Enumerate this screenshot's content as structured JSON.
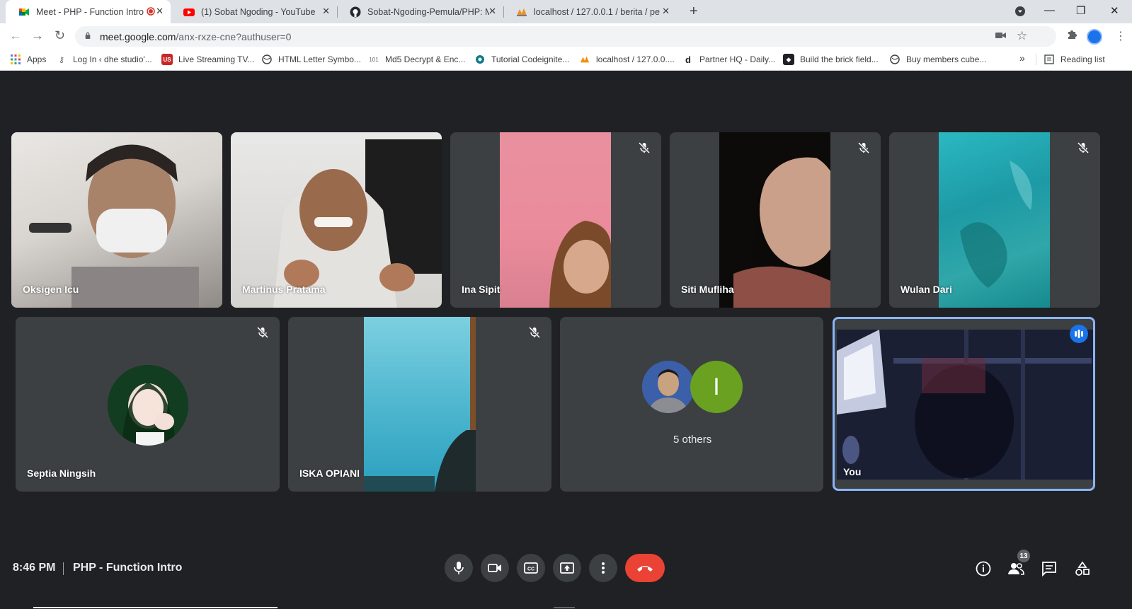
{
  "browser": {
    "tabs": [
      {
        "title": "Meet - PHP - Function Intro",
        "icon": "google-meet-icon",
        "active": true
      },
      {
        "title": "(1) Sobat Ngoding - YouTube",
        "icon": "youtube-icon",
        "active": false
      },
      {
        "title": "Sobat-Ngoding-Pemula/PHP: Ma",
        "icon": "github-icon",
        "active": false
      },
      {
        "title": "localhost / 127.0.0.1 / berita / pe",
        "icon": "phpmyadmin-icon",
        "active": false
      }
    ],
    "url_host": "meet.google.com",
    "url_path": "/anx-rxze-cne?authuser=0",
    "bookmarks": [
      {
        "label": "Apps",
        "icon": "apps-grid-icon"
      },
      {
        "label": "Log In ‹ dhe studio'...",
        "icon": "key-icon"
      },
      {
        "label": "Live Streaming TV...",
        "icon": "tv-icon"
      },
      {
        "label": "HTML Letter Symbo...",
        "icon": "globe-icon"
      },
      {
        "label": "Md5 Decrypt & Enc...",
        "icon": "md5-icon"
      },
      {
        "label": "Tutorial Codeignite...",
        "icon": "codeigniter-icon"
      },
      {
        "label": "localhost / 127.0.0....",
        "icon": "phpmyadmin-icon"
      },
      {
        "label": "Partner HQ - Daily...",
        "icon": "d-icon"
      },
      {
        "label": "Build the brick field...",
        "icon": "brick-icon"
      },
      {
        "label": "Buy members cube...",
        "icon": "globe-icon"
      }
    ],
    "overflow": "»",
    "reading_list": "Reading list"
  },
  "meet": {
    "participants_row1": [
      {
        "name": "Oksigen Icu",
        "muted": false
      },
      {
        "name": "Martinus Pratama",
        "muted": false
      },
      {
        "name": "Ina Sipit",
        "muted": true
      },
      {
        "name": "Siti Mufliha",
        "muted": true
      },
      {
        "name": "Wulan Dari",
        "muted": true
      }
    ],
    "participants_row2": [
      {
        "name": "Septia Ningsih",
        "muted": true
      },
      {
        "name": "ISKA OPIANI",
        "muted": true
      },
      {
        "name": "5 others",
        "others_letter": "I"
      },
      {
        "name": "You",
        "speaking": true
      }
    ],
    "bottom": {
      "time": "8:46 PM",
      "title": "PHP - Function Intro",
      "participants_count": "13"
    },
    "colors": {
      "background": "#202124",
      "tile": "#3c4043",
      "hangup": "#ea4335",
      "accent": "#1a73e8",
      "others_avatar": "#6aa121"
    }
  }
}
